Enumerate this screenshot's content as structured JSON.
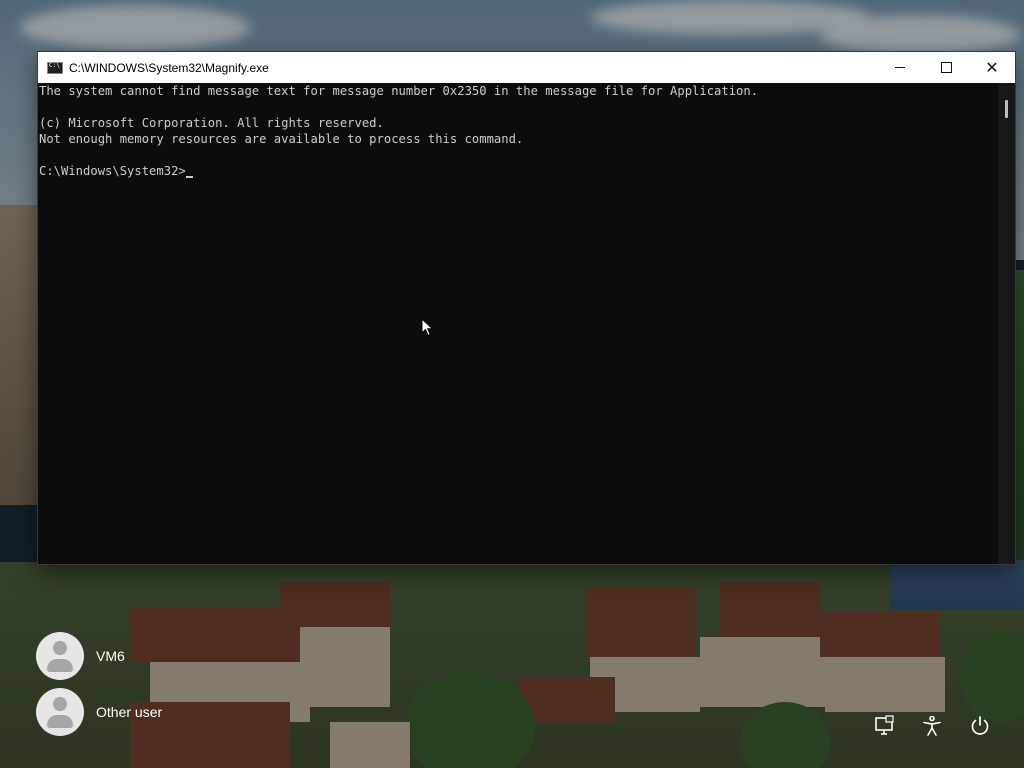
{
  "window": {
    "title": "C:\\WINDOWS\\System32\\Magnify.exe",
    "minimize_icon": "minimize-icon",
    "maximize_icon": "maximize-icon",
    "close_icon": "close-icon"
  },
  "console": {
    "lines": [
      "The system cannot find message text for message number 0x2350 in the message file for Application.",
      "",
      "(c) Microsoft Corporation. All rights reserved.",
      "Not enough memory resources are available to process this command.",
      "",
      "C:\\Windows\\System32>"
    ]
  },
  "users": [
    {
      "name": "VM6"
    },
    {
      "name": "Other user"
    }
  ],
  "system_icons": [
    "network-icon",
    "accessibility-icon",
    "power-icon"
  ]
}
